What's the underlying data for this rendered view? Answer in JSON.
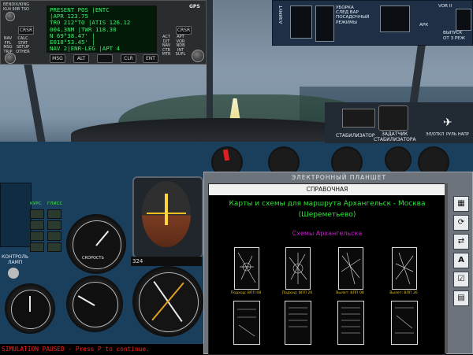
{
  "gps": {
    "brand_line1": "BENDIX/KING",
    "brand_line2": "KLN 90B TSO",
    "badge": "GPS",
    "screen_rows": [
      "PRESENT POS |ENTC",
      "            |APR 123.75",
      "TRO  212°TO |ATIS 126.12",
      "    004.3NM |TWR  118.30",
      "N 69°38.47' |",
      "E018°53.45' |",
      "NAV 2|ENR-LEG |APT 4"
    ],
    "left_labels": [
      "NAV",
      "FPL",
      "MSG",
      "TRIP"
    ],
    "left_labels2": [
      "CALC",
      "STAT",
      "SETUP",
      "OTHER"
    ],
    "right_labels": [
      "APT",
      "VOR",
      "NDB",
      "INT",
      "SUPL"
    ],
    "right_labels2": [
      "ACT",
      "D/T",
      "NAV",
      "CTR",
      "MTR"
    ],
    "crsr_left": "CRSR",
    "crsr_right": "CRSR",
    "buttons": [
      "MSG",
      "ALT",
      "",
      "CLR",
      "ENT"
    ]
  },
  "autopilot": {
    "label_left": "АЗИМУТ",
    "label_col1": "УБОРКА",
    "label_col2": "СЛЕД ВАР",
    "label_col3": "ПОСАДОЧНЫЙ",
    "label_col4": "РЕЖИМЫ",
    "label_ark": "АРК",
    "label_vor": "VOR II",
    "label_release": "ВЫПУСК",
    "label_release2": "ОТ 3 РЕЖ"
  },
  "panels": {
    "stabilizer": "СТАБИЛИЗАТОР",
    "stabilizer_set": "ЗАДАТЧИК",
    "stabilizer_set2": "СТАБИЛИЗАТОРА",
    "el_label": "ЭЛ/ОТКЛ",
    "trim_label": "РУЛЬ НАПР",
    "course_label": "КУРС",
    "glide_label": "ГЛИСС",
    "lamp_check": "КОНТРОЛЬ",
    "lamp_check2": "ЛАМП",
    "speed_label": "СКОРОСТЬ",
    "alt_value": "324"
  },
  "tablet": {
    "title": "ЭЛЕКТРОННЫЙ ПЛАНШЕТ",
    "header": "СПРАВОЧНАЯ",
    "route_title": "Карты и схемы для маршрута Архангельск - Москва (Шереметьево)",
    "subtitle": "Схемы Архангельска",
    "charts": [
      {
        "caption": "Подход: ВПП 08"
      },
      {
        "caption": "Подход: ВПП 26"
      },
      {
        "caption": "Вылет: ВПП 08"
      },
      {
        "caption": "Вылет: ВПП 26"
      }
    ],
    "side_buttons": [
      "grid-icon",
      "refresh-icon",
      "swap-icon",
      "font-icon",
      "check-icon",
      "notes-icon"
    ]
  },
  "status": {
    "paused_text": "SIMULATION PAUSED - Press P to continue."
  },
  "colors": {
    "dashboard": "#1a3f5d",
    "gps_text": "#3cf06b",
    "route_title": "#2fe43a",
    "subtitle": "#d11bd6",
    "paused": "#ff2020"
  }
}
